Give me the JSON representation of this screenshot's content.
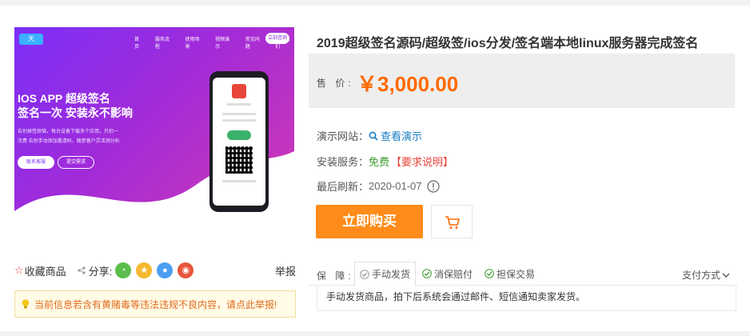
{
  "product": {
    "title": "2019超级签名源码/超级签/ios分发/签名端本地linux服务器完成签名",
    "price_label": "售 价:",
    "price": "￥3,000.00"
  },
  "banner": {
    "logo": "天",
    "nav": [
      "首页",
      "服务流程",
      "使用场景",
      "视频演示",
      "常见问题",
      "联系我们"
    ],
    "nav_button": "立刻咨询",
    "headline": "IOS APP 超级签名",
    "subline": "签名一次 安装永不影响",
    "desc": "告别掉签烦恼，每台设备下载多个应用，只扣一次费 告别手动添加邀请码，随意客户灵活测分析",
    "button1": "联系客服",
    "button2": "提交需求"
  },
  "details": {
    "demo_label": "演示网站：",
    "demo_link": "查看演示",
    "install_label": "安装服务：",
    "install_value": "免费",
    "install_note": "【要求说明】",
    "refresh_label": "最后刷新：",
    "refresh_date": "2020-01-07"
  },
  "actions": {
    "buy": "立即购买"
  },
  "social": {
    "favorite": "收藏商品",
    "share": "分享:",
    "report": "举报"
  },
  "warning": "当前信息若含有黄赌毒等违法违规不良内容，请点此举报!",
  "guarantee": {
    "label": "保 障:",
    "tabs": [
      "手动发货",
      "消保赔付",
      "担保交易"
    ],
    "pay_method": "支付方式",
    "description": "手动发货商品，拍下后系统会通过邮件、短信通知卖家发货。"
  },
  "colors": {
    "price": "#ff6a00",
    "buy_button": "#ff8c1a",
    "link": "#1a7fc4",
    "free": "#3a9b2e",
    "warning_text": "#e06b1e"
  }
}
